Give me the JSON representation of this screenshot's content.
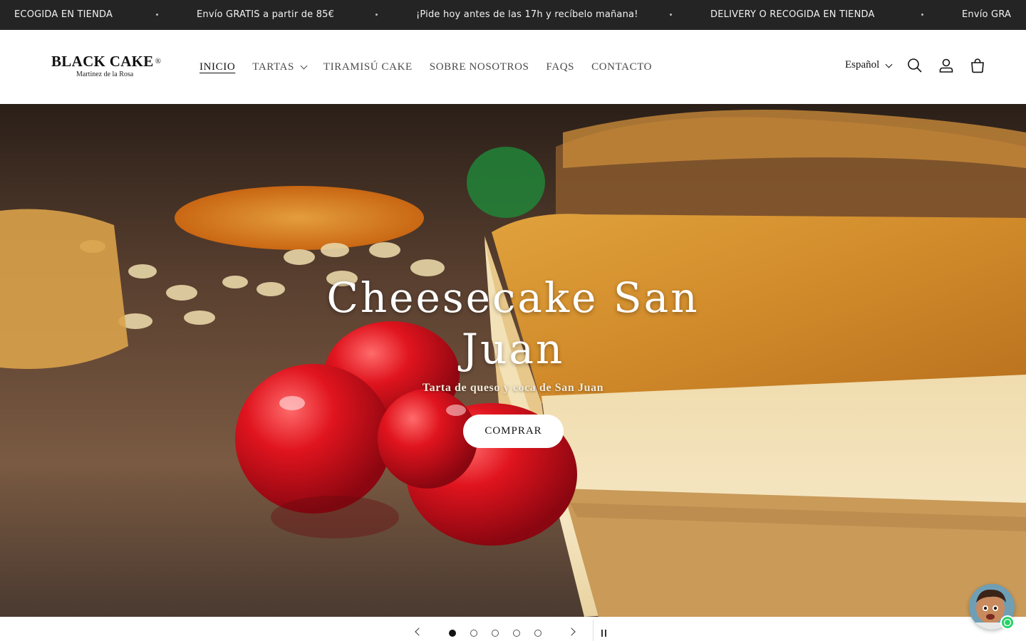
{
  "announcement": {
    "items": [
      "ECOGIDA EN TIENDA",
      "Envío GRATIS a partir de 85€",
      "¡Pide hoy antes de las 17h y recíbelo mañana!",
      "DELIVERY O RECOGIDA EN TIENDA",
      "Envío GRA"
    ]
  },
  "header": {
    "logo_title": "BLACK CAKE",
    "logo_reg": "®",
    "logo_subtitle": "Martinez de la Rosa",
    "nav": [
      {
        "label": "INICIO",
        "active": true
      },
      {
        "label": "TARTAS",
        "has_dropdown": true
      },
      {
        "label": "TIRAMISÚ CAKE"
      },
      {
        "label": "SOBRE NOSOTROS"
      },
      {
        "label": "FAQS"
      },
      {
        "label": "CONTACTO"
      }
    ],
    "language": "Español",
    "icons": [
      "search-icon",
      "account-icon",
      "cart-icon"
    ]
  },
  "hero": {
    "title": "Cheesecake San Juan",
    "subtitle": "Tarta de queso y coca de San Juan",
    "cta": "COMPRAR"
  },
  "slider": {
    "slide_count": 5,
    "active_slide": 1
  },
  "colors": {
    "announcement_bg": "#242424",
    "accent_whatsapp": "#25d366"
  }
}
